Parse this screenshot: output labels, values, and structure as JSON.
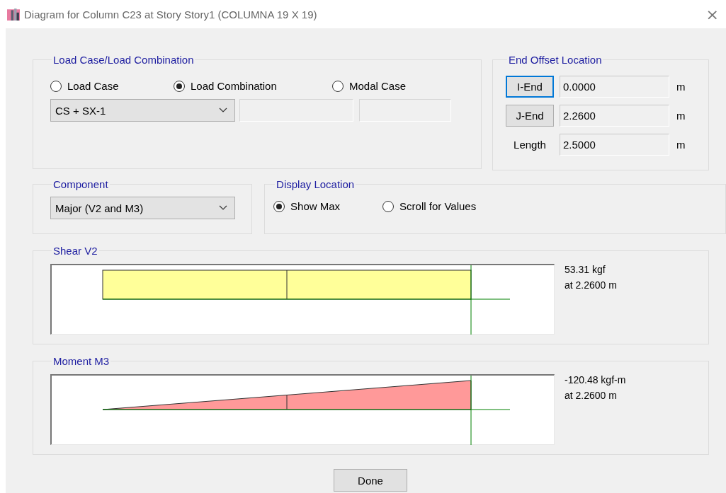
{
  "window": {
    "title": "Diagram for Column C23 at Story Story1 (COLUMNA 19 X 19)",
    "close": "×"
  },
  "load_case": {
    "title": "Load Case/Load Combination",
    "options": [
      {
        "label": "Load Case",
        "selected": false
      },
      {
        "label": "Load Combination",
        "selected": true
      },
      {
        "label": "Modal Case",
        "selected": false
      }
    ],
    "combo_value": "CS + SX-1"
  },
  "end_offset": {
    "title": "End Offset Location",
    "rows": [
      {
        "kind": "button",
        "label": "I-End",
        "focused": true,
        "value": "0.0000",
        "unit": "m"
      },
      {
        "kind": "button",
        "label": "J-End",
        "focused": false,
        "value": "2.2600",
        "unit": "m"
      },
      {
        "kind": "label",
        "label": "Length",
        "value": "2.5000",
        "unit": "m"
      }
    ]
  },
  "component": {
    "title": "Component",
    "value": "Major (V2 and M3)"
  },
  "display_location": {
    "title": "Display Location",
    "options": [
      {
        "label": "Show Max",
        "selected": true
      },
      {
        "label": "Scroll for Values",
        "selected": false
      }
    ]
  },
  "diagrams": [
    {
      "kind": "shear",
      "title": "Shear V2",
      "value": "53.31 kgf",
      "location": "at 2.2600 m"
    },
    {
      "kind": "moment",
      "title": "Moment M3",
      "value": "-120.48 kgf-m",
      "location": "at 2.2600 m"
    }
  ],
  "buttons": [
    "Done"
  ]
}
